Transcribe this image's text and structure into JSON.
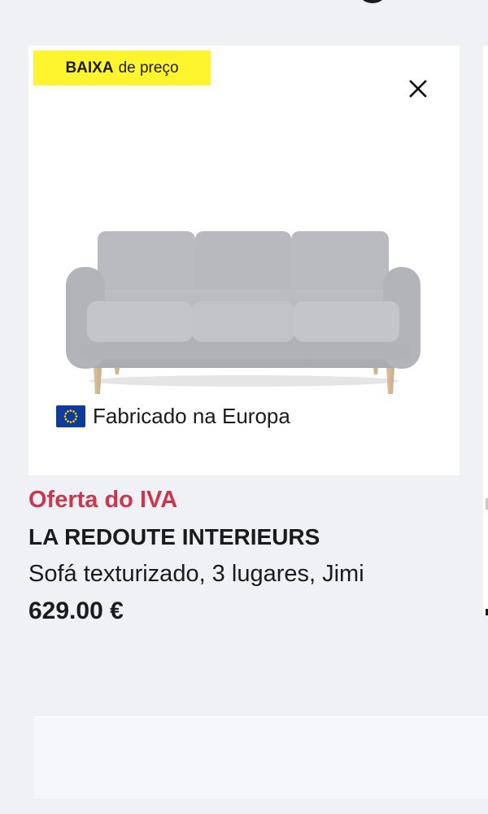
{
  "product_card": {
    "badge": {
      "strong_text": "BAIXA",
      "normal_text": "de preço",
      "background_color": "#fff52e"
    },
    "close_icon": "close-icon",
    "product_image": "sofa-image",
    "origin_label": {
      "flag_icon": "eu-flag-icon",
      "text": "Fabricado na Europa"
    }
  },
  "product_info": {
    "offer_tag": "Oferta do IVA",
    "offer_color": "#c8374f",
    "brand": "LA REDOUTE INTERIEURS",
    "title": "Sofá texturizado, 3 lugares, Jimi",
    "price": "629.00 €"
  }
}
